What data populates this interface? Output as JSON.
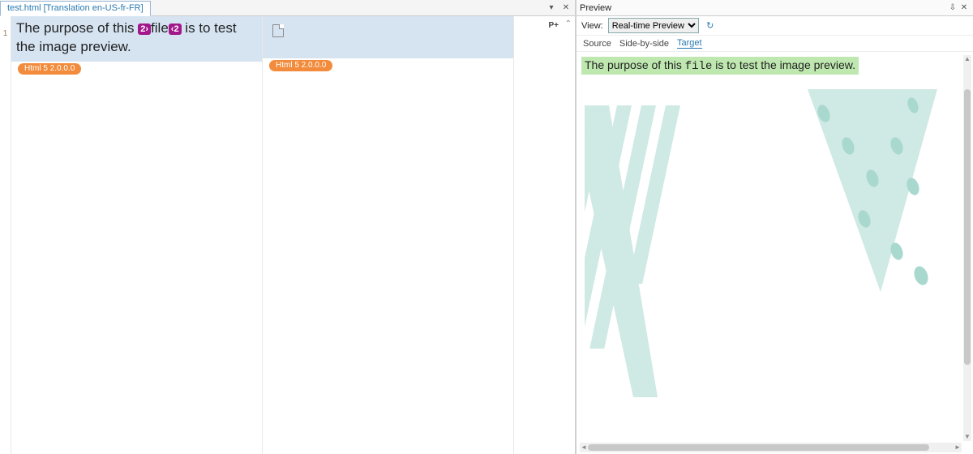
{
  "editor": {
    "tab_label": "test.html [Translation en-US-fr-FR]",
    "toolbar": {
      "dropdown_glyph": "▾",
      "close_glyph": "✕"
    },
    "row_number": "1",
    "segment": {
      "before": "The purpose of this ",
      "tag_open": "2›",
      "tagged_word": "file",
      "tag_close": "‹2",
      "after": " is to test the image preview."
    },
    "filter_label": "Html 5 2.0.0.0",
    "p_plus": "P+",
    "scroll_up_glyph": "⌃"
  },
  "preview": {
    "panel_title": "Preview",
    "pin_glyph": "⇩",
    "close_glyph": "✕",
    "view_label": "View:",
    "view_options": [
      "Real-time Preview"
    ],
    "view_selected": "Real-time Preview",
    "refresh_glyph": "↻",
    "tabs": {
      "source": "Source",
      "side": "Side-by-side",
      "target": "Target"
    },
    "active_tab": "target",
    "rendered": {
      "before": "The purpose of this ",
      "code": "file",
      "after": " is to test the image preview."
    },
    "colors": {
      "highlight_bg": "#bfe8b0",
      "shape_fill": "#cfe9e4"
    }
  }
}
